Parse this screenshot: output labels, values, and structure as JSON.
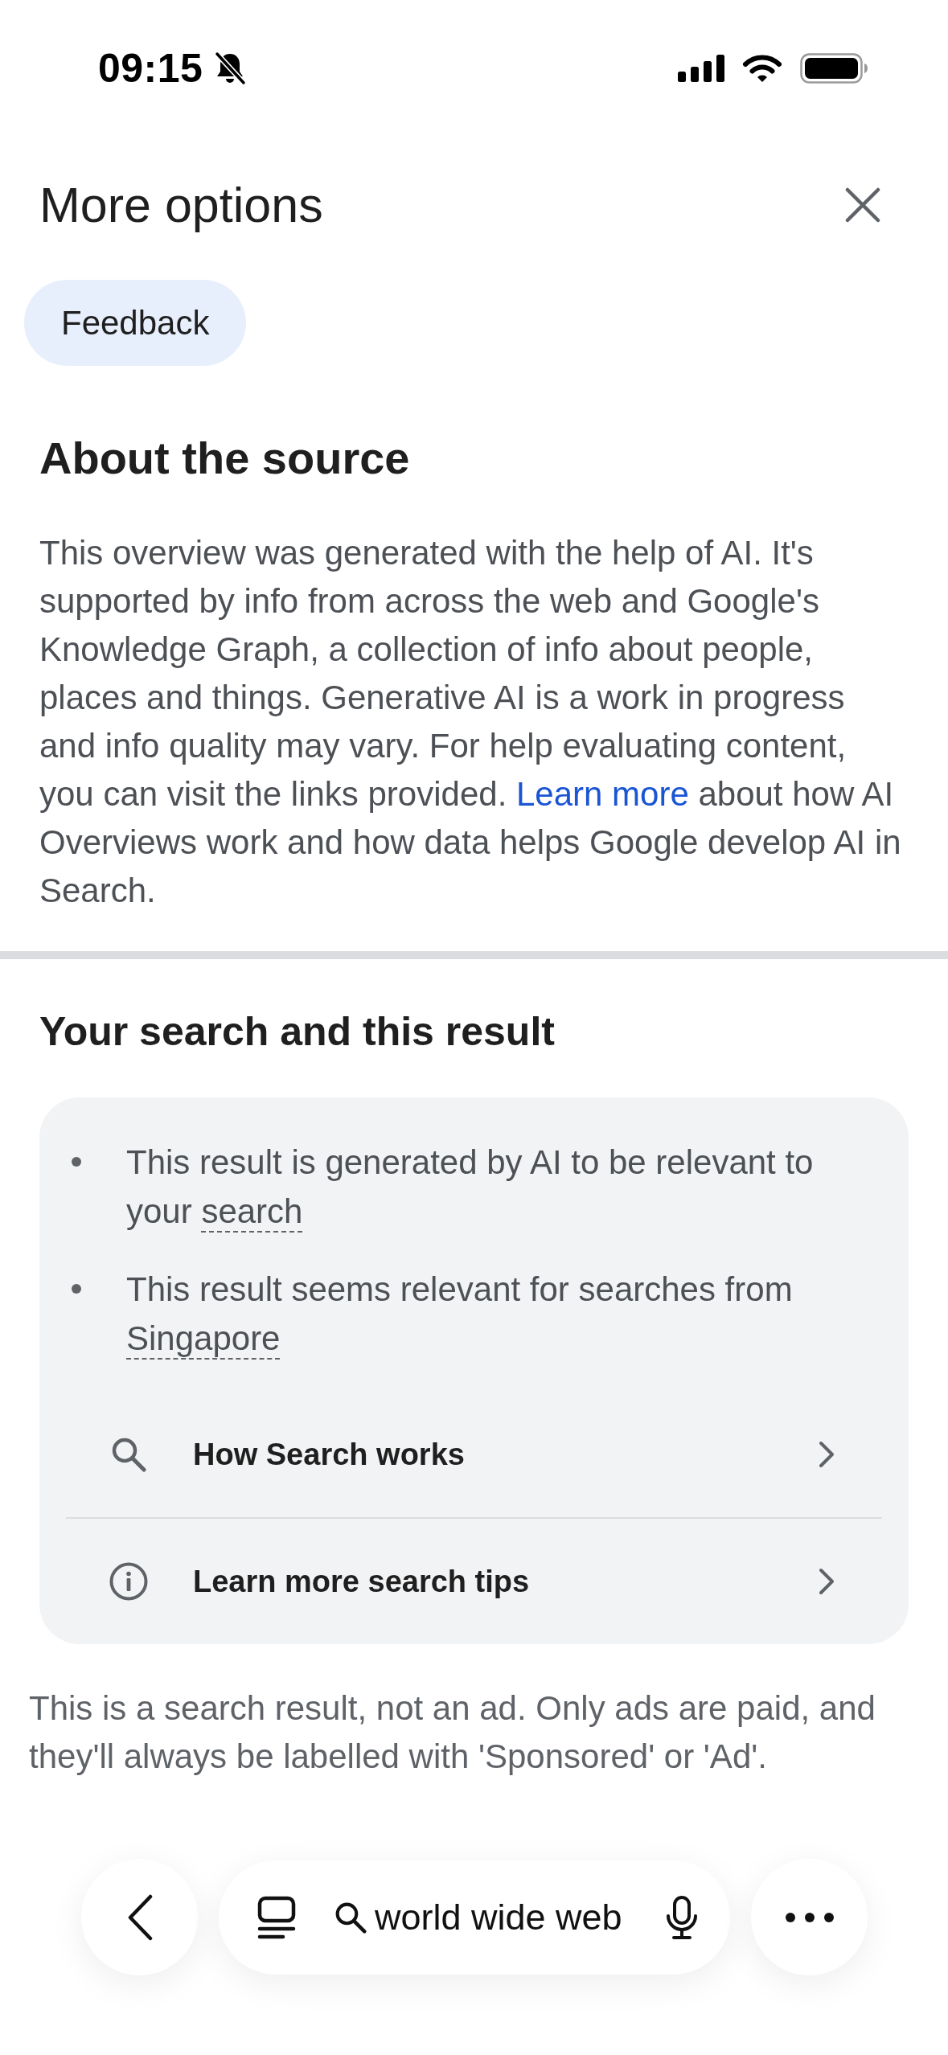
{
  "status_bar": {
    "time": "09:15",
    "silent": true
  },
  "header": {
    "title": "More options"
  },
  "feedback_button": {
    "label": "Feedback"
  },
  "about_section": {
    "heading": "About the source",
    "paragraph": {
      "before": "This overview was generated with the help of AI. It's supported by info from across the web and Google's Knowledge Graph, a collection of info about people, places and things. Generative AI is a work in progress and info quality may vary. For help evaluating content, you can visit the links provided.",
      "link": "Learn more",
      "after": "about how AI Overviews work and how data helps Google develop AI in Search."
    }
  },
  "result_section": {
    "heading": "Your search and this result",
    "bullets": [
      {
        "text": "This result is generated by AI to be relevant to your",
        "term": "search"
      },
      {
        "text": "This result seems relevant for searches from",
        "term": "Singapore"
      }
    ],
    "links": [
      {
        "kind": "search",
        "label": "How Search works"
      },
      {
        "kind": "info",
        "label": "Learn more search tips"
      }
    ]
  },
  "disclaimer": "This is a search result, not an ad. Only ads are paid, and they'll always be labelled with 'Sponsored' or 'Ad'.",
  "bottom_bar": {
    "query": "world wide web"
  }
}
